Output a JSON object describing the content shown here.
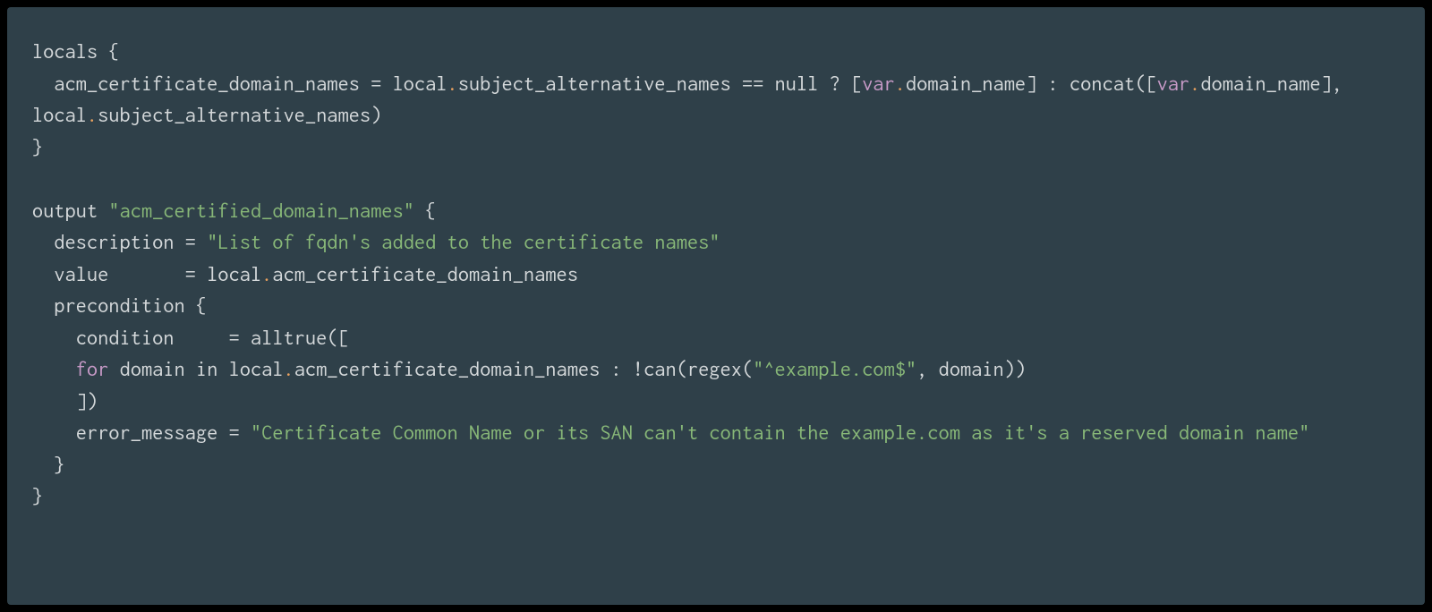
{
  "code": {
    "tokens": [
      {
        "t": "locals {",
        "c": "default"
      },
      {
        "t": "\n",
        "c": "default"
      },
      {
        "t": "  acm_certificate_domain_names = local",
        "c": "default"
      },
      {
        "t": ".",
        "c": "orange"
      },
      {
        "t": "subject_alternative_names == null ? [",
        "c": "default"
      },
      {
        "t": "var",
        "c": "mauve"
      },
      {
        "t": ".",
        "c": "orange"
      },
      {
        "t": "domain_name] : concat([",
        "c": "default"
      },
      {
        "t": "var",
        "c": "mauve"
      },
      {
        "t": ".",
        "c": "orange"
      },
      {
        "t": "domain_name], local",
        "c": "default"
      },
      {
        "t": ".",
        "c": "orange"
      },
      {
        "t": "subject_alternative_names)",
        "c": "default"
      },
      {
        "t": "\n",
        "c": "default"
      },
      {
        "t": "}",
        "c": "default"
      },
      {
        "t": "\n",
        "c": "default"
      },
      {
        "t": "\n",
        "c": "default"
      },
      {
        "t": "output ",
        "c": "default"
      },
      {
        "t": "\"acm_certified_domain_names\"",
        "c": "green"
      },
      {
        "t": " {",
        "c": "default"
      },
      {
        "t": "\n",
        "c": "default"
      },
      {
        "t": "  description = ",
        "c": "default"
      },
      {
        "t": "\"List of fqdn's added to the certificate names\"",
        "c": "green"
      },
      {
        "t": "\n",
        "c": "default"
      },
      {
        "t": "  value       = local",
        "c": "default"
      },
      {
        "t": ".",
        "c": "orange"
      },
      {
        "t": "acm_certificate_domain_names",
        "c": "default"
      },
      {
        "t": "\n",
        "c": "default"
      },
      {
        "t": "  precondition {",
        "c": "default"
      },
      {
        "t": "\n",
        "c": "default"
      },
      {
        "t": "    condition     = alltrue([",
        "c": "default"
      },
      {
        "t": "\n",
        "c": "default"
      },
      {
        "t": "    ",
        "c": "default"
      },
      {
        "t": "for",
        "c": "mauve"
      },
      {
        "t": " domain in local",
        "c": "default"
      },
      {
        "t": ".",
        "c": "orange"
      },
      {
        "t": "acm_certificate_domain_names : !can(regex(",
        "c": "default"
      },
      {
        "t": "\"^example.com$\"",
        "c": "green"
      },
      {
        "t": ", domain))",
        "c": "default"
      },
      {
        "t": "\n",
        "c": "default"
      },
      {
        "t": "    ])",
        "c": "default"
      },
      {
        "t": "\n",
        "c": "default"
      },
      {
        "t": "    error_message = ",
        "c": "default"
      },
      {
        "t": "\"Certificate Common Name or its SAN can't contain the example.com as it's a reserved domain name\"",
        "c": "green"
      },
      {
        "t": "\n",
        "c": "default"
      },
      {
        "t": "  }",
        "c": "default"
      },
      {
        "t": "\n",
        "c": "default"
      },
      {
        "t": "}",
        "c": "default"
      }
    ]
  },
  "colors": {
    "background": "#2f4049",
    "outer": "#000000",
    "default": "#d4d8da",
    "orange": "#e8a05e",
    "green": "#88b878",
    "mauve": "#c79ac7"
  }
}
